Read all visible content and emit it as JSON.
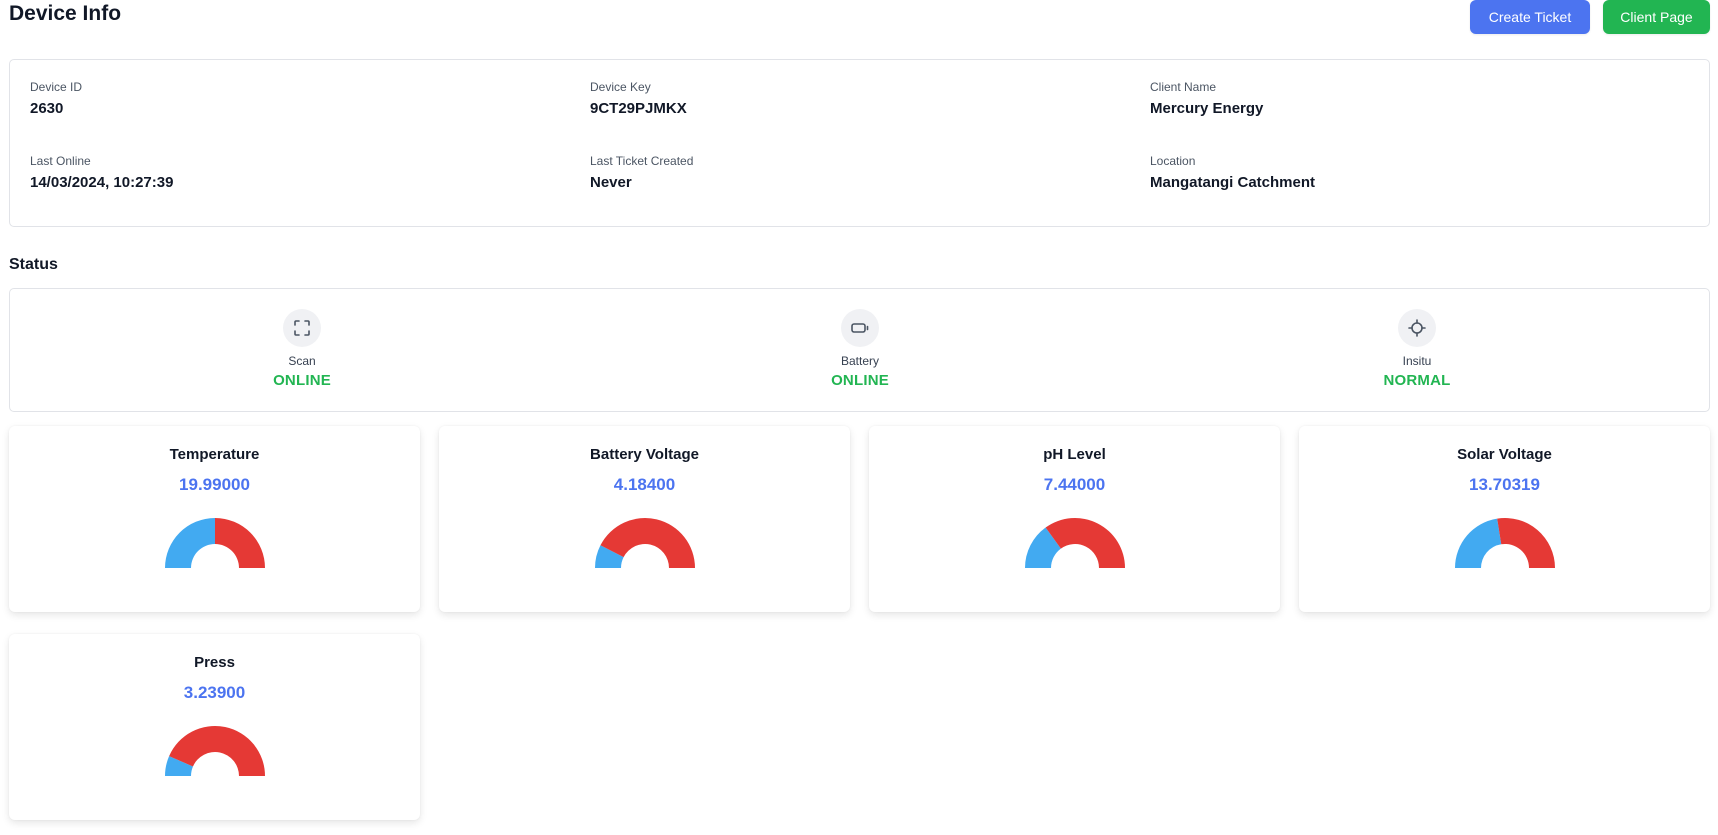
{
  "header": {
    "title": "Device Info",
    "create_ticket_label": "Create Ticket",
    "client_page_label": "Client Page"
  },
  "device": {
    "fields": [
      {
        "label": "Device ID",
        "value": "2630"
      },
      {
        "label": "Device Key",
        "value": "9CT29PJMKX"
      },
      {
        "label": "Client Name",
        "value": "Mercury Energy"
      },
      {
        "label": "Last Online",
        "value": "14/03/2024, 10:27:39"
      },
      {
        "label": "Last Ticket Created",
        "value": "Never"
      },
      {
        "label": "Location",
        "value": "Mangatangi Catchment"
      }
    ]
  },
  "status": {
    "title": "Status",
    "items": [
      {
        "label": "Scan",
        "value": "ONLINE",
        "icon": "scan-icon"
      },
      {
        "label": "Battery",
        "value": "ONLINE",
        "icon": "battery-icon"
      },
      {
        "label": "Insitu",
        "value": "NORMAL",
        "icon": "crosshair-icon"
      }
    ]
  },
  "metrics": [
    {
      "title": "Temperature",
      "value": "19.99000",
      "fill_fraction": 0.5
    },
    {
      "title": "Battery Voltage",
      "value": "4.18400",
      "fill_fraction": 0.15
    },
    {
      "title": "pH Level",
      "value": "7.44000",
      "fill_fraction": 0.3
    },
    {
      "title": "Solar Voltage",
      "value": "13.70319",
      "fill_fraction": 0.45
    },
    {
      "title": "Press",
      "value": "3.23900",
      "fill_fraction": 0.13
    }
  ],
  "colors": {
    "accent_blue": "#4c74f0",
    "success_green": "#22b552",
    "gauge_blue": "#42aaf1",
    "gauge_red": "#e53935"
  }
}
